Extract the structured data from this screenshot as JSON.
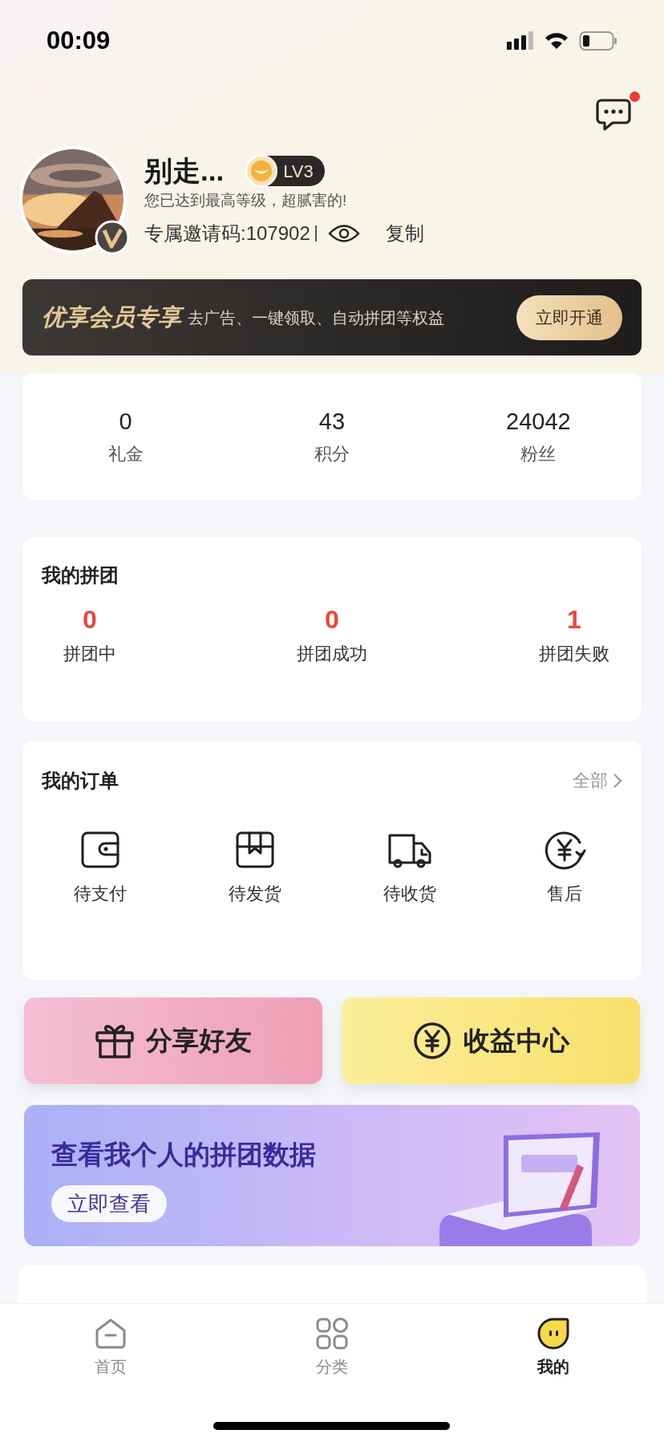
{
  "status_bar": {
    "time": "00:09"
  },
  "header": {
    "unread_messages": true
  },
  "profile": {
    "name": "别走...",
    "level": "LV3",
    "subtitle": "您已达到最高等级，超腻害的!",
    "invite_code": "专属邀请码:107902",
    "copy": "复制"
  },
  "vip_banner": {
    "title": "优享会员专享",
    "text": "去广告、一键领取、自动拼团等权益",
    "button": "立即开通"
  },
  "stats": [
    {
      "value": "0",
      "label": "礼金"
    },
    {
      "value": "43",
      "label": "积分"
    },
    {
      "value": "24042",
      "label": "粉丝"
    }
  ],
  "group_buy": {
    "title": "我的拼团",
    "items": [
      {
        "value": "0",
        "label": "拼团中"
      },
      {
        "value": "0",
        "label": "拼团成功"
      },
      {
        "value": "1",
        "label": "拼团失败"
      }
    ]
  },
  "orders": {
    "title": "我的订单",
    "all": "全部",
    "items": [
      {
        "kind": "wallet",
        "label": "待支付"
      },
      {
        "kind": "box",
        "label": "待发货"
      },
      {
        "kind": "truck",
        "label": "待收货"
      },
      {
        "kind": "refund",
        "label": "售后"
      }
    ]
  },
  "actions": [
    {
      "kind": "gift",
      "label": "分享好友"
    },
    {
      "kind": "income",
      "label": "收益中心"
    }
  ],
  "data_banner": {
    "title": "查看我个人的拼团数据",
    "button": "立即查看"
  },
  "tabs": [
    {
      "kind": "home",
      "label": "首页",
      "selected": false
    },
    {
      "kind": "category",
      "label": "分类",
      "selected": false
    },
    {
      "kind": "me",
      "label": "我的",
      "selected": true
    }
  ]
}
